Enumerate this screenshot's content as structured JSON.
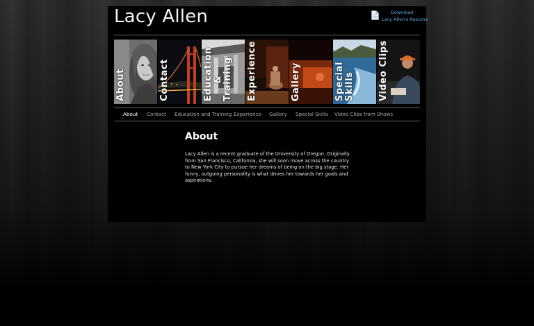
{
  "site": {
    "title": "Lacy Allen"
  },
  "resume": {
    "line1": "Download",
    "line2": "Lacy Allen's Resume",
    "icon": "document-icon"
  },
  "tiles": [
    {
      "label": "About"
    },
    {
      "label": "Contact"
    },
    {
      "label": "Education\n     &\nTraining"
    },
    {
      "label": "Experience"
    },
    {
      "label": "Gallery"
    },
    {
      "label": "Special\nSkills"
    },
    {
      "label": "Video Clips"
    }
  ],
  "nav": {
    "items": [
      {
        "label": "About"
      },
      {
        "label": "Contact"
      },
      {
        "label": "Education and Training"
      },
      {
        "label": "Experience"
      },
      {
        "label": "Gallery"
      },
      {
        "label": "Special Skills"
      },
      {
        "label": "Video Clips from Shows"
      }
    ],
    "active_index": 0
  },
  "content": {
    "title": "About",
    "body": "Lacy Allen is a recent graduate of the University of Oregon. Originally from San Francisco, California, she will soon move across the country to New York City to pursue her dreams of being on the big stage. Her funny, outgoing personality is what drives her towards her goals and aspirations."
  },
  "colors": {
    "link": "#5aa9e6",
    "page_bg": "#000000",
    "divider": "#6a6a6a"
  }
}
